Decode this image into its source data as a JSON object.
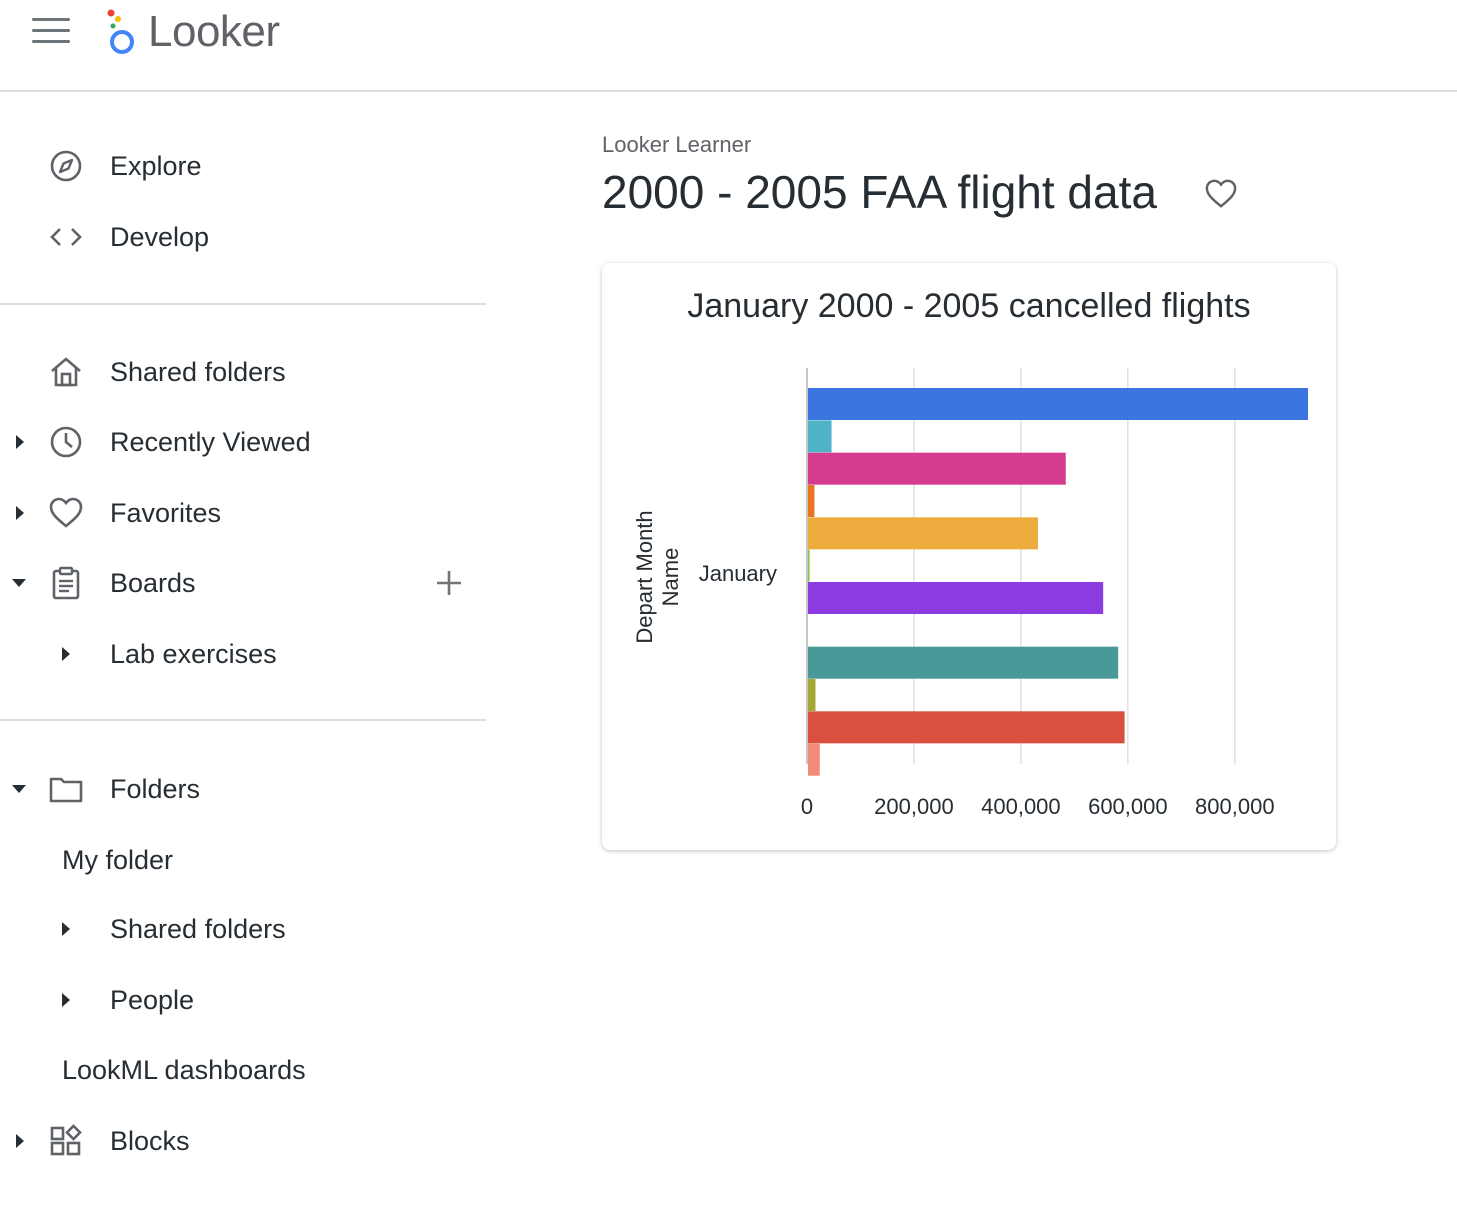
{
  "app": {
    "name": "Looker"
  },
  "icons": {
    "menu": "hamburger-menu-icon",
    "explore": "compass-icon",
    "develop": "code-icon",
    "shared": "home-icon",
    "recent": "clock-icon",
    "favorites": "heart-icon",
    "boards": "clipboard-icon",
    "folders": "folder-icon",
    "blocks": "blocks-icon",
    "add": "plus-icon"
  },
  "sidebar": {
    "explore": "Explore",
    "develop": "Develop",
    "shared_folders": "Shared folders",
    "recently_viewed": "Recently Viewed",
    "favorites": "Favorites",
    "boards": "Boards",
    "lab_exercises": "Lab exercises",
    "folders": "Folders",
    "my_folder": "My folder",
    "folders_shared": "Shared folders",
    "people": "People",
    "lookml_dashboards": "LookML dashboards",
    "blocks": "Blocks"
  },
  "main": {
    "breadcrumb": "Looker Learner",
    "title": "2000 - 2005 FAA flight data"
  },
  "chart_data": {
    "type": "bar",
    "orientation": "horizontal",
    "title": "January 2000 - 2005 cancelled flights",
    "ylabel": "Depart Month Name",
    "xlabel": "",
    "categories": [
      "January"
    ],
    "xlim": [
      0,
      935000
    ],
    "xticks": [
      "0",
      "200,000",
      "400,000",
      "600,000",
      "800,000"
    ],
    "xtick_values": [
      0,
      200000,
      400000,
      600000,
      800000
    ],
    "grid": true,
    "legend": "none",
    "series": [
      {
        "values": [
          935000
        ],
        "color": "#3b75e0"
      },
      {
        "values": [
          44000
        ],
        "color": "#4fb3c8"
      },
      {
        "values": [
          482000
        ],
        "color": "#d63c8e"
      },
      {
        "values": [
          12000
        ],
        "color": "#e8741f"
      },
      {
        "values": [
          430000
        ],
        "color": "#ecab3c"
      },
      {
        "values": [
          3000
        ],
        "color": "#8bc34a"
      },
      {
        "values": [
          552000
        ],
        "color": "#8c3be0"
      },
      {
        "values": [
          0
        ],
        "color": "#7b3fd0"
      },
      {
        "values": [
          580000
        ],
        "color": "#479a98"
      },
      {
        "values": [
          14000
        ],
        "color": "#a5a836"
      },
      {
        "values": [
          592000
        ],
        "color": "#d9503e"
      },
      {
        "values": [
          22000
        ],
        "color": "#f28b7a"
      }
    ]
  }
}
